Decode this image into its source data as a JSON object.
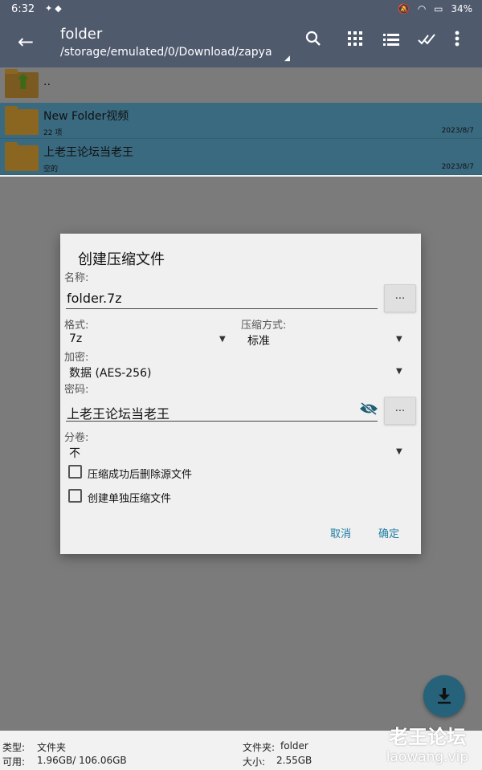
{
  "status_bar": {
    "time": "6:32",
    "battery": "34%"
  },
  "toolbar": {
    "title": "folder",
    "path": "/storage/emulated/0/Download/zapya"
  },
  "files": [
    {
      "name": "..",
      "meta": "",
      "date": "",
      "kind": "up"
    },
    {
      "name": "New Folder视频",
      "meta": "22 项",
      "date": "2023/8/7",
      "kind": "folder"
    },
    {
      "name": "上老王论坛当老王",
      "meta": "空的",
      "date": "2023/8/7",
      "kind": "folder"
    }
  ],
  "dialog": {
    "title": "创建压缩文件",
    "name_label": "名称:",
    "name_value": "folder.7z",
    "dots": "...",
    "format_label": "格式:",
    "format_value": "7z",
    "method_label": "压缩方式:",
    "method_value": "标准",
    "encryption_label": "加密:",
    "encryption_value": "数据 (AES-256)",
    "password_label": "密码:",
    "password_value": "上老王论坛当老王",
    "split_label": "分卷:",
    "split_value": "不",
    "option1": "压缩成功后删除源文件",
    "option2": "创建单独压缩文件",
    "cancel": "取消",
    "ok": "确定"
  },
  "footer": {
    "type_label": "类型:",
    "type_value": "文件夹",
    "free_label": "可用:",
    "free_value": "1.96GB/ 106.06GB",
    "folder_label": "文件夹:",
    "folder_value": "folder",
    "size_label": "大小:",
    "size_value": "2.55GB"
  },
  "watermark": {
    "line1": "老王论坛",
    "line2": "laowang.vip"
  },
  "colors": {
    "toolbar": "#505a6d",
    "selected_row": "#3a6a80",
    "accent": "#1f7ea2",
    "fab": "#26627a"
  }
}
